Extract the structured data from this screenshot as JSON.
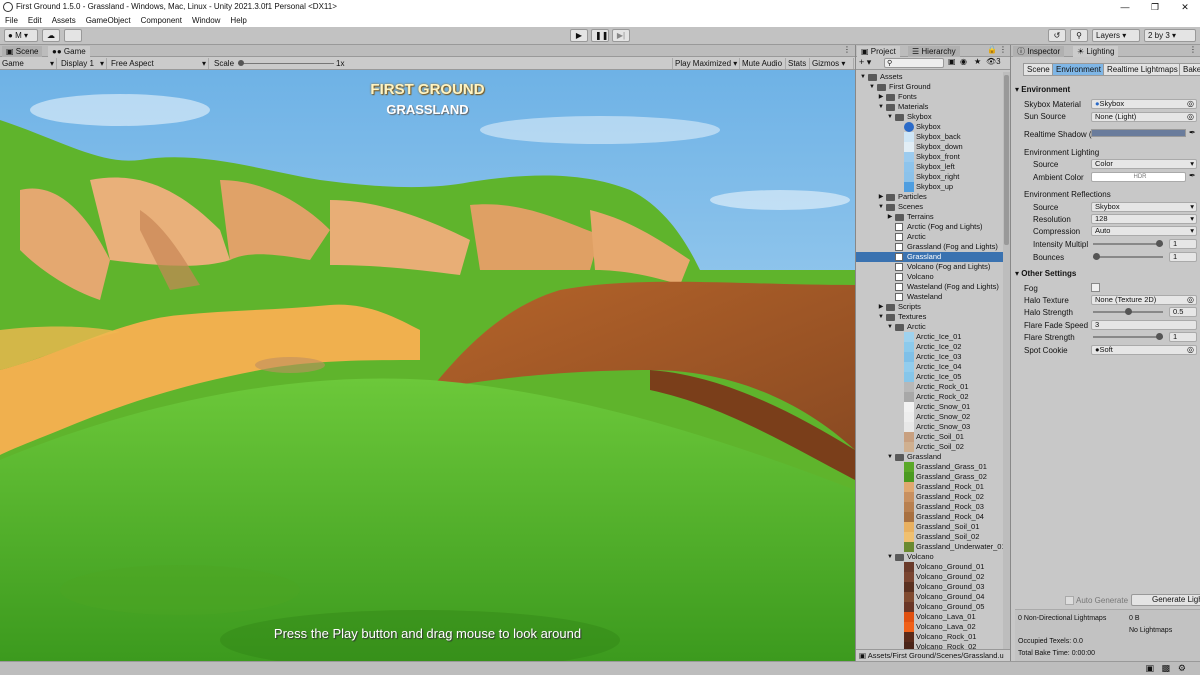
{
  "window": {
    "title": "First Ground 1.5.0 - Grassland - Windows, Mac, Linux - Unity 2021.3.0f1 Personal <DX11>"
  },
  "menu": [
    "File",
    "Edit",
    "Assets",
    "GameObject",
    "Component",
    "Window",
    "Help"
  ],
  "toolbar": {
    "account": "M",
    "layers": "Layers",
    "layout": "2 by 3"
  },
  "view_tabs": {
    "scene": "Scene",
    "game": "Game"
  },
  "game_bar": {
    "mode": "Game",
    "display": "Display 1",
    "aspect": "Free Aspect",
    "scale_label": "Scale",
    "scale_value": "1x",
    "play_maximized": "Play Maximized",
    "mute_audio": "Mute Audio",
    "stats": "Stats",
    "gizmos": "Gizmos"
  },
  "game_view": {
    "title": "FIRST GROUND",
    "subtitle": "GRASSLAND",
    "hint": "Press the Play button and drag mouse to look around"
  },
  "project": {
    "tab_project": "Project",
    "tab_hierarchy": "Hierarchy",
    "hidden_count": "3",
    "footer_path": "Assets/First Ground/Scenes/Grassland.u",
    "tree": [
      {
        "label": "Assets",
        "kind": "folder",
        "indent": 0,
        "expanded": true
      },
      {
        "label": "First Ground",
        "kind": "folder",
        "indent": 1,
        "expanded": true
      },
      {
        "label": "Fonts",
        "kind": "folder",
        "indent": 2,
        "expanded": false
      },
      {
        "label": "Materials",
        "kind": "folder",
        "indent": 2,
        "expanded": true
      },
      {
        "label": "Skybox",
        "kind": "folder",
        "indent": 3,
        "expanded": true
      },
      {
        "label": "Skybox",
        "kind": "material",
        "indent": 4,
        "color": "#2a6ac8"
      },
      {
        "label": "Skybox_back",
        "kind": "texture",
        "indent": 4,
        "color": "#cfe6f6"
      },
      {
        "label": "Skybox_down",
        "kind": "texture",
        "indent": 4,
        "color": "#e2eef6"
      },
      {
        "label": "Skybox_front",
        "kind": "texture",
        "indent": 4,
        "color": "#9ccbee"
      },
      {
        "label": "Skybox_left",
        "kind": "texture",
        "indent": 4,
        "color": "#8ec4ec"
      },
      {
        "label": "Skybox_right",
        "kind": "texture",
        "indent": 4,
        "color": "#8cc2ea"
      },
      {
        "label": "Skybox_up",
        "kind": "texture",
        "indent": 4,
        "color": "#4f9ee0"
      },
      {
        "label": "Particles",
        "kind": "folder",
        "indent": 2,
        "expanded": false
      },
      {
        "label": "Scenes",
        "kind": "folder",
        "indent": 2,
        "expanded": true
      },
      {
        "label": "Terrains",
        "kind": "folder",
        "indent": 3,
        "expanded": false
      },
      {
        "label": "Arctic (Fog and Lights)",
        "kind": "scene",
        "indent": 3
      },
      {
        "label": "Arctic",
        "kind": "scene",
        "indent": 3
      },
      {
        "label": "Grassland (Fog and Lights)",
        "kind": "scene",
        "indent": 3
      },
      {
        "label": "Grassland",
        "kind": "scene",
        "indent": 3,
        "selected": true
      },
      {
        "label": "Volcano (Fog and Lights)",
        "kind": "scene",
        "indent": 3
      },
      {
        "label": "Volcano",
        "kind": "scene",
        "indent": 3
      },
      {
        "label": "Wasteland (Fog and Lights)",
        "kind": "scene",
        "indent": 3
      },
      {
        "label": "Wasteland",
        "kind": "scene",
        "indent": 3
      },
      {
        "label": "Scripts",
        "kind": "folder",
        "indent": 2,
        "expanded": false
      },
      {
        "label": "Textures",
        "kind": "folder",
        "indent": 2,
        "expanded": true
      },
      {
        "label": "Arctic",
        "kind": "folder",
        "indent": 3,
        "expanded": true
      },
      {
        "label": "Arctic_Ice_01",
        "kind": "texture",
        "indent": 4,
        "color": "#9fd2ee"
      },
      {
        "label": "Arctic_Ice_02",
        "kind": "texture",
        "indent": 4,
        "color": "#8ccaec"
      },
      {
        "label": "Arctic_Ice_03",
        "kind": "texture",
        "indent": 4,
        "color": "#7fc0e8"
      },
      {
        "label": "Arctic_Ice_04",
        "kind": "texture",
        "indent": 4,
        "color": "#92cdee"
      },
      {
        "label": "Arctic_Ice_05",
        "kind": "texture",
        "indent": 4,
        "color": "#86c6ea"
      },
      {
        "label": "Arctic_Rock_01",
        "kind": "texture",
        "indent": 4,
        "color": "#b8b8b8"
      },
      {
        "label": "Arctic_Rock_02",
        "kind": "texture",
        "indent": 4,
        "color": "#a8a8a8"
      },
      {
        "label": "Arctic_Snow_01",
        "kind": "texture",
        "indent": 4,
        "color": "#f2f2f2"
      },
      {
        "label": "Arctic_Snow_02",
        "kind": "texture",
        "indent": 4,
        "color": "#eeeeee"
      },
      {
        "label": "Arctic_Snow_03",
        "kind": "texture",
        "indent": 4,
        "color": "#e8e8e8"
      },
      {
        "label": "Arctic_Soil_01",
        "kind": "texture",
        "indent": 4,
        "color": "#c8a080"
      },
      {
        "label": "Arctic_Soil_02",
        "kind": "texture",
        "indent": 4,
        "color": "#d0b090"
      },
      {
        "label": "Grassland",
        "kind": "folder",
        "indent": 3,
        "expanded": true
      },
      {
        "label": "Grassland_Grass_01",
        "kind": "texture",
        "indent": 4,
        "color": "#5aa828"
      },
      {
        "label": "Grassland_Grass_02",
        "kind": "texture",
        "indent": 4,
        "color": "#4a9a20"
      },
      {
        "label": "Grassland_Rock_01",
        "kind": "texture",
        "indent": 4,
        "color": "#e0a870"
      },
      {
        "label": "Grassland_Rock_02",
        "kind": "texture",
        "indent": 4,
        "color": "#c89060"
      },
      {
        "label": "Grassland_Rock_03",
        "kind": "texture",
        "indent": 4,
        "color": "#b88050"
      },
      {
        "label": "Grassland_Rock_04",
        "kind": "texture",
        "indent": 4,
        "color": "#a87040"
      },
      {
        "label": "Grassland_Soil_01",
        "kind": "texture",
        "indent": 4,
        "color": "#e8b060"
      },
      {
        "label": "Grassland_Soil_02",
        "kind": "texture",
        "indent": 4,
        "color": "#f0c070"
      },
      {
        "label": "Grassland_Underwater_01",
        "kind": "texture",
        "indent": 4,
        "color": "#6a8a30"
      },
      {
        "label": "Volcano",
        "kind": "folder",
        "indent": 3,
        "expanded": true
      },
      {
        "label": "Volcano_Ground_01",
        "kind": "texture",
        "indent": 4,
        "color": "#6a3a2a"
      },
      {
        "label": "Volcano_Ground_02",
        "kind": "texture",
        "indent": 4,
        "color": "#7a4430"
      },
      {
        "label": "Volcano_Ground_03",
        "kind": "texture",
        "indent": 4,
        "color": "#5a3020"
      },
      {
        "label": "Volcano_Ground_04",
        "kind": "texture",
        "indent": 4,
        "color": "#804a30"
      },
      {
        "label": "Volcano_Ground_05",
        "kind": "texture",
        "indent": 4,
        "color": "#6a3626"
      },
      {
        "label": "Volcano_Lava_01",
        "kind": "texture",
        "indent": 4,
        "color": "#e05010"
      },
      {
        "label": "Volcano_Lava_02",
        "kind": "texture",
        "indent": 4,
        "color": "#f06018"
      },
      {
        "label": "Volcano_Rock_01",
        "kind": "texture",
        "indent": 4,
        "color": "#5a2a1a"
      },
      {
        "label": "Volcano_Rock_02",
        "kind": "texture",
        "indent": 4,
        "color": "#4a2418"
      }
    ]
  },
  "inspector": {
    "tab_inspector": "Inspector",
    "tab_lighting": "Lighting",
    "lighting_tabs": [
      "Scene",
      "Environment",
      "Realtime Lightmaps",
      "Bake"
    ],
    "environment_header": "Environment",
    "skybox_material_label": "Skybox Material",
    "skybox_material_value": "Skybox",
    "sun_source_label": "Sun Source",
    "sun_source_value": "None (Light)",
    "realtime_shadow_label": "Realtime Shadow (",
    "realtime_shadow_color": "#6a7c9c",
    "env_lighting_label": "Environment Lighting",
    "env_source_label": "Source",
    "env_source_value": "Color",
    "ambient_label": "Ambient Color",
    "ambient_value": "HDR",
    "env_reflections_label": "Environment Reflections",
    "refl_source_label": "Source",
    "refl_source_value": "Skybox",
    "resolution_label": "Resolution",
    "resolution_value": "128",
    "compression_label": "Compression",
    "compression_value": "Auto",
    "intensity_label": "Intensity Multipl",
    "intensity_value": "1",
    "intensity_fraction": 1,
    "bounces_label": "Bounces",
    "bounces_value": "1",
    "bounces_fraction": 0,
    "other_header": "Other Settings",
    "fog_label": "Fog",
    "halo_texture_label": "Halo Texture",
    "halo_texture_value": "None (Texture 2D)",
    "halo_strength_label": "Halo Strength",
    "halo_strength_value": "0.5",
    "halo_strength_fraction": 0.5,
    "flare_fade_label": "Flare Fade Speed",
    "flare_fade_value": "3",
    "flare_strength_label": "Flare Strength",
    "flare_strength_value": "1",
    "flare_strength_fraction": 1,
    "spot_cookie_label": "Spot Cookie",
    "spot_cookie_value": "Soft",
    "auto_generate": "Auto Generate",
    "generate_button": "Generate Ligh",
    "stat_lightmaps": "0 Non-Directional Lightmaps",
    "stat_size": "0 B",
    "stat_no_lightmaps": "No Lightmaps",
    "stat_texels": "Occupied Texels: 0.0",
    "stat_bake_time": "Total Bake Time: 0:00:00"
  }
}
